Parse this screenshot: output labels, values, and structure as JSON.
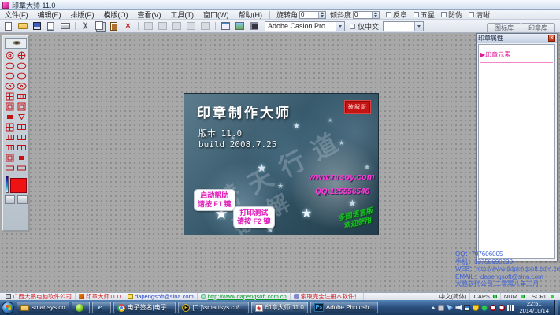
{
  "window": {
    "title": "印章大师 11.0"
  },
  "menu": {
    "items": [
      "文件(F)",
      "编辑(E)",
      "排版(P)",
      "模版(O)",
      "查看(V)",
      "工具(T)",
      "窗口(W)",
      "帮助(H)"
    ]
  },
  "transform": {
    "rotation_label": "旋转角",
    "rotation_value": "0",
    "skew_label": "倾斜度",
    "skew_value": "0",
    "options": [
      "反章",
      "五星",
      "防伪",
      "清晰"
    ]
  },
  "toolbar": {
    "font_value": "Adobe Caslon Pro",
    "only_chinese_label": "仅中文"
  },
  "library_tabs": {
    "icon_lib": "图标库",
    "seal_lib": "印章库"
  },
  "properties_panel": {
    "title": "印章属性",
    "section_header": "▶印章元素"
  },
  "splash": {
    "title": "印章制作大师",
    "stamp_text": "破解版",
    "version_line": "版本 11.0",
    "build_line": "build 2008.7.25",
    "help_bubble_line1": "启动帮助",
    "help_bubble_line2": "请按 F1 键",
    "print_bubble_line1": "打印测试",
    "print_bubble_line2": "请按 F2 键",
    "website": "www.nrsoy.com",
    "qq": "QQ:125556546",
    "watermark_text": "替天行道",
    "watermark_text2": "破解",
    "edition_line1": "多国语言版",
    "edition_line2": "欢迎使用"
  },
  "contact": {
    "qq": "QQ：707606005",
    "mobile": "手机：13758690230",
    "web": "WEB：http://www.dapengsoft.com.cn",
    "email": "EMAIL：dapengsoft@sina.com",
    "company": "大鹏软件公司 二零零八年三月"
  },
  "statusbar": {
    "company": "广西大鹏电脑软件公司",
    "product": "印章大师11.0",
    "email": "dapengsoft@sina.com",
    "web": "http://www.dapengsoft.com.cn",
    "promo": "索取完全注册本软件！",
    "ime": "中文(简体)",
    "caps": "CAPS",
    "num": "NUM",
    "scrl": "SCRL"
  },
  "taskbar": {
    "items": [
      {
        "label": "smartsys.cn",
        "icon": "folder-icon"
      },
      {
        "label": "",
        "icon": "green-sphere-icon"
      },
      {
        "label": "",
        "icon": "internet-explorer-icon"
      },
      {
        "label": "电子签名|电子...",
        "icon": "chrome-icon"
      },
      {
        "label": "[D:]\\smartsys.cn\\...",
        "icon": "e-circle-icon"
      },
      {
        "label": "印章大师 11.0",
        "icon": "seal-star-icon"
      },
      {
        "label": "Adobe Photosh...",
        "icon": "photoshop-icon"
      }
    ],
    "clock_time": "22:51",
    "clock_date": "2014/10/14"
  },
  "colors": {
    "magenta": "#e018b8",
    "seal_red": "#c11214",
    "status_green": "#0a9a28",
    "splash_bg": "#35586a",
    "link_blue": "#3f62d8"
  }
}
